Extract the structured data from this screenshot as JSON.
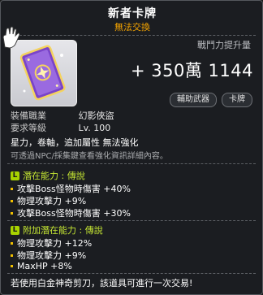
{
  "header": {
    "title": "新者卡牌",
    "trade_status": "無法交換"
  },
  "power": {
    "label": "戰鬥力提升量",
    "prefix": "+",
    "value": "350萬 1144"
  },
  "tags": [
    "輔助武器",
    "卡牌"
  ],
  "stats": [
    {
      "key": "裝備職業",
      "value": "幻影俠盜"
    },
    {
      "key": "要求等級",
      "value": "Lv. 100"
    }
  ],
  "description": {
    "line1": "星力，卷軸，追加屬性 無法強化",
    "line2": "可透過NPC/採集鍵查看強化資訊詳細內容。"
  },
  "potential": {
    "label": "潛在能力 : 傳說",
    "lines": [
      "攻擊Boss怪物時傷害 +40%",
      "物理攻擊力 +9%",
      "攻擊Boss怪物時傷害 +30%"
    ]
  },
  "bonus_potential": {
    "label": "附加潛在能力 : 傳說",
    "lines": [
      "物理攻擊力 +12%",
      "物理攻擊力 +9%",
      "MaxHP +8%"
    ]
  },
  "footer": "若使用白金神奇剪刀，該道具可進行一次交易!",
  "colors": {
    "trade": "#f5a400",
    "legend": "#c5e633",
    "accent_badge": "#a8d300"
  },
  "icons": {
    "item": "purple-card-icon",
    "cursor": "glove-cursor-icon",
    "badge": "L-grade-icon"
  }
}
